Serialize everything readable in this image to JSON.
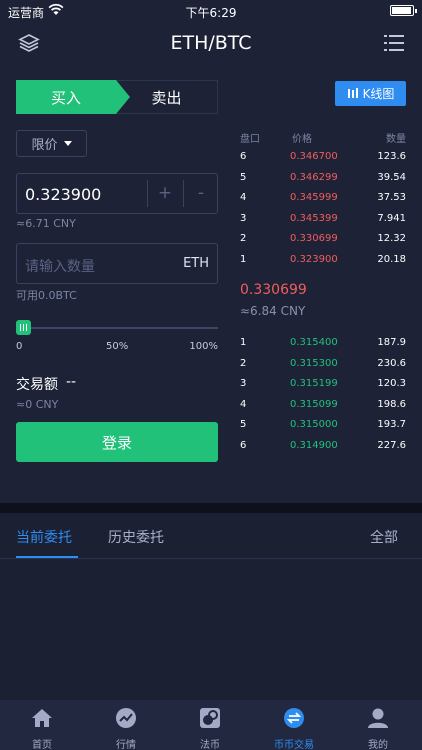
{
  "status_bar": {
    "carrier": "运营商",
    "time": "下午6:29",
    "battery_level": 0.95
  },
  "navbar": {
    "title": "ETH/BTC"
  },
  "trade": {
    "buy_tab": "买入",
    "sell_tab": "卖出",
    "kline_button": "K线图",
    "order_type": "限价",
    "price_value": "0.323900",
    "plus": "+",
    "minus": "-",
    "price_cny": "≈6.71 CNY",
    "amount_placeholder": "请输入数量",
    "amount_unit": "ETH",
    "available": "可用0.0BTC",
    "slider_value": 0,
    "slider_labels": {
      "min": "0",
      "mid": "50%",
      "max": "100%"
    },
    "volume_label": "交易额",
    "volume_value": "--",
    "volume_cny": "≈0 CNY",
    "login_button": "登录"
  },
  "orderbook": {
    "headers": {
      "level": "盘口",
      "price": "价格",
      "qty": "数量"
    },
    "asks": [
      {
        "idx": "6",
        "price": "0.346700",
        "qty": "123.6"
      },
      {
        "idx": "5",
        "price": "0.346299",
        "qty": "39.54"
      },
      {
        "idx": "4",
        "price": "0.345999",
        "qty": "37.53"
      },
      {
        "idx": "3",
        "price": "0.345399",
        "qty": "7.941"
      },
      {
        "idx": "2",
        "price": "0.330699",
        "qty": "12.32"
      },
      {
        "idx": "1",
        "price": "0.323900",
        "qty": "20.18"
      }
    ],
    "last_price": "0.330699",
    "last_price_cny": "≈6.84 CNY",
    "bids": [
      {
        "idx": "1",
        "price": "0.315400",
        "qty": "187.9"
      },
      {
        "idx": "2",
        "price": "0.315300",
        "qty": "230.6"
      },
      {
        "idx": "3",
        "price": "0.315199",
        "qty": "120.3"
      },
      {
        "idx": "4",
        "price": "0.315099",
        "qty": "198.6"
      },
      {
        "idx": "5",
        "price": "0.315000",
        "qty": "193.7"
      },
      {
        "idx": "6",
        "price": "0.314900",
        "qty": "227.6"
      }
    ]
  },
  "orders_tabs": {
    "current": "当前委托",
    "history": "历史委托",
    "all": "全部"
  },
  "bottom_nav": [
    {
      "label": "首页",
      "icon": "home-icon"
    },
    {
      "label": "行情",
      "icon": "market-trend-icon"
    },
    {
      "label": "法币",
      "icon": "fiat-icon"
    },
    {
      "label": "币币交易",
      "icon": "exchange-icon",
      "active": true
    },
    {
      "label": "我的",
      "icon": "profile-icon"
    }
  ],
  "colors": {
    "accent": "#2f8cf0",
    "buy": "#21c17a",
    "sell": "#f05e5e",
    "background": "#1b2033"
  }
}
